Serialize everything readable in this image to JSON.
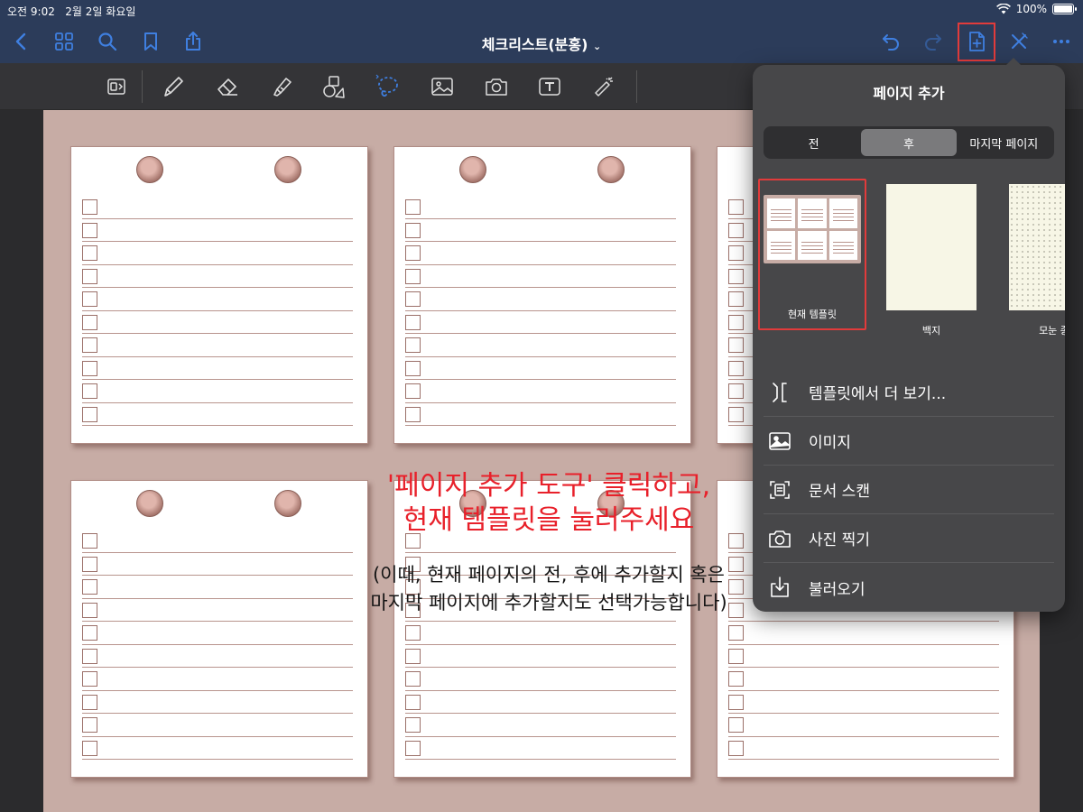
{
  "status": {
    "time": "오전 9:02",
    "date": "2월 2일 화요일",
    "battery": "100%",
    "battery_level": 1.0
  },
  "nav": {
    "title": "체크리스트(분홍)",
    "accent": "#3f7fe0",
    "highlight": "#e23b3b"
  },
  "toolbar": {
    "lasso_hint": "abc"
  },
  "instructions": {
    "line1": "'페이지 추가 도구' 클릭하고,",
    "line2": "현재 템플릿을 눌러주세요",
    "line3": "(이때, 현재 페이지의 전, 후에 추가할지 혹은",
    "line4": "마지막 페이지에 추가할지도 선택가능합니다)"
  },
  "popover": {
    "title": "페이지 추가",
    "segments": [
      "전",
      "후",
      "마지막 페이지"
    ],
    "selected_segment": "후",
    "templates": [
      {
        "label": "현재 템플릿"
      },
      {
        "label": "백지"
      },
      {
        "label": "모눈 종"
      }
    ],
    "menu": [
      {
        "label": "템플릿에서 더 보기...",
        "icon": "template-bracket-icon"
      },
      {
        "label": "이미지",
        "icon": "image-icon"
      },
      {
        "label": "문서 스캔",
        "icon": "doc-scan-icon"
      },
      {
        "label": "사진 찍기",
        "icon": "camera-icon"
      },
      {
        "label": "불러오기",
        "icon": "import-icon"
      }
    ]
  },
  "colors": {
    "page_bg": "#c7aca5",
    "checkbox": "#9b7069",
    "pin": "#a8786f",
    "instruction_red": "#e8202a"
  }
}
